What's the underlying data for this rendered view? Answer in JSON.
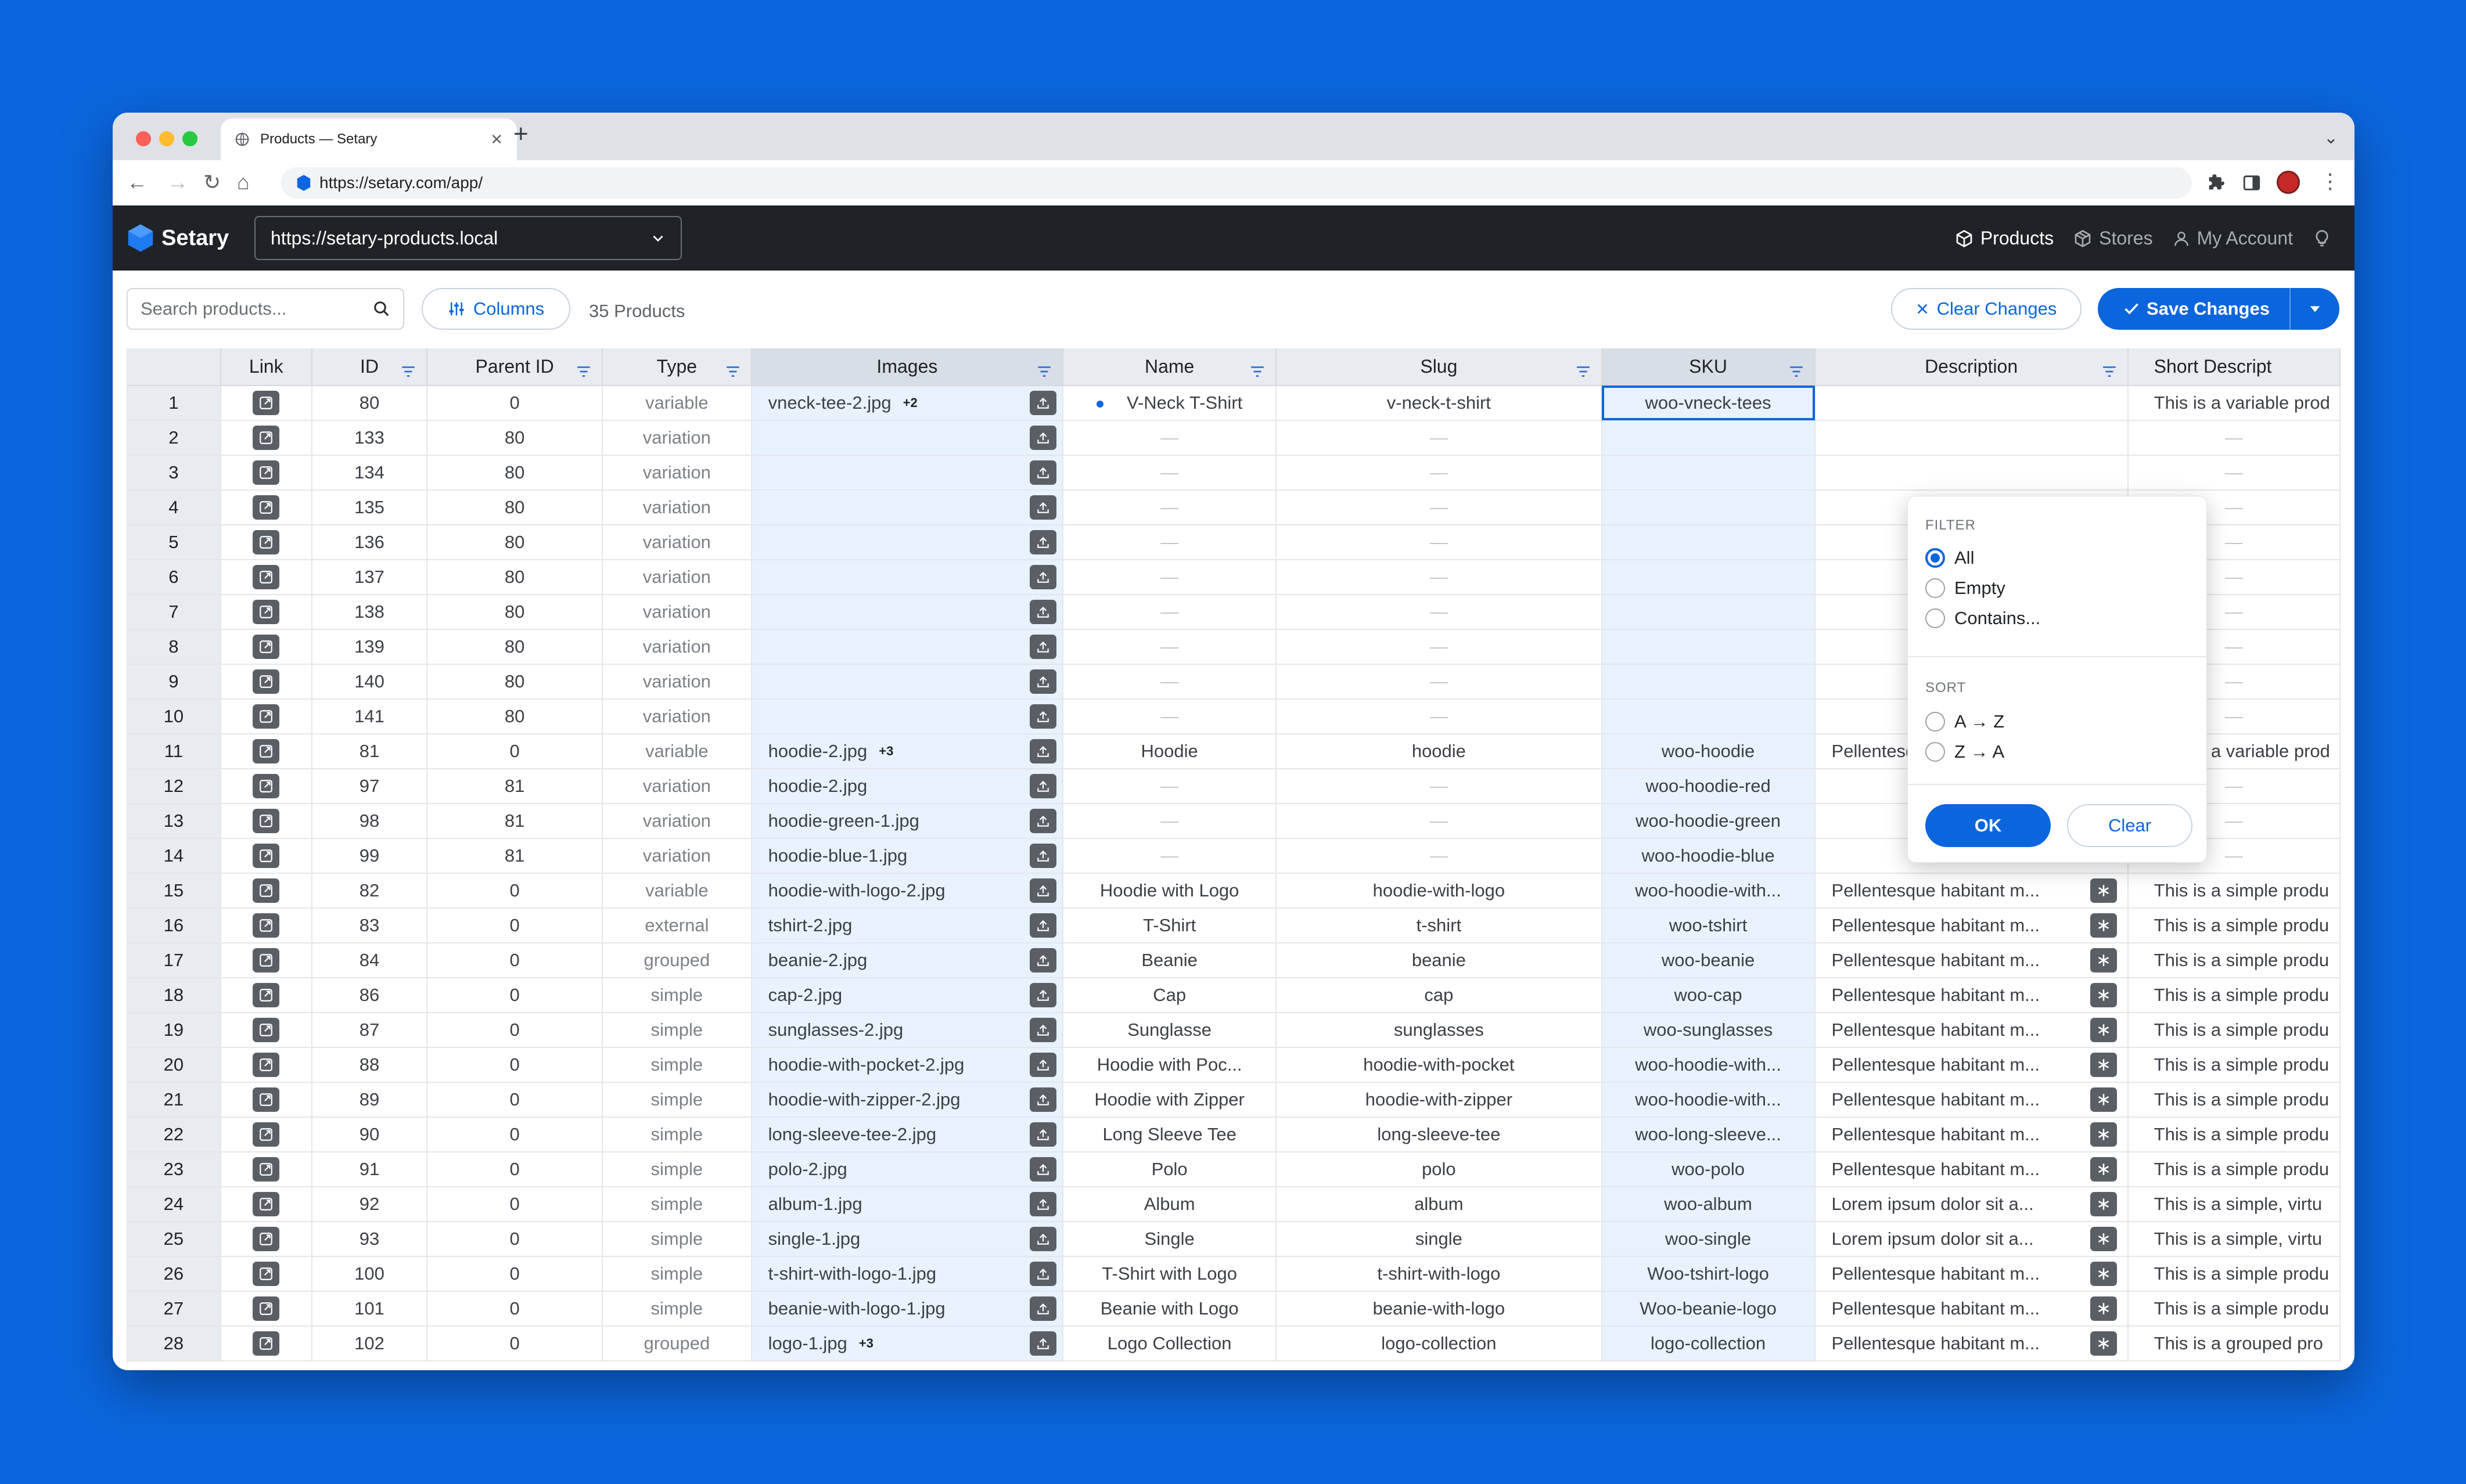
{
  "browser": {
    "tab_title": "Products — Setary",
    "url": "https://setary.com/app/",
    "traffic_colors": [
      "#FF5F57",
      "#FEBC2E",
      "#28C840"
    ]
  },
  "app": {
    "brand": "Setary",
    "site": "https://setary-products.local",
    "nav": [
      {
        "label": "Products",
        "icon": "box-icon",
        "active": true
      },
      {
        "label": "Stores",
        "icon": "cube-icon",
        "active": false
      },
      {
        "label": "My Account",
        "icon": "user-icon",
        "active": false
      }
    ]
  },
  "toolbar": {
    "search_placeholder": "Search products...",
    "columns_label": "Columns",
    "count_label": "35 Products",
    "clear_label": "Clear Changes",
    "save_label": "Save Changes"
  },
  "columns": [
    "",
    "Link",
    "ID",
    "Parent ID",
    "Type",
    "Images",
    "Name",
    "Slug",
    "SKU",
    "Description",
    "Short Descript"
  ],
  "rows": [
    {
      "n": "1",
      "id": "80",
      "parent": "0",
      "type": "variable",
      "img": "vneck-tee-2.jpg",
      "badge": "+2",
      "name": "V-Neck T-Shirt",
      "slug": "v-neck-t-shirt",
      "sku": "woo-vneck-tees",
      "desc": "",
      "sdesc": "This is a variable prod"
    },
    {
      "n": "2",
      "id": "133",
      "parent": "80",
      "type": "variation",
      "img": "",
      "badge": "",
      "name": "—",
      "slug": "—",
      "sku": "",
      "desc": "",
      "sdesc": "—"
    },
    {
      "n": "3",
      "id": "134",
      "parent": "80",
      "type": "variation",
      "img": "",
      "badge": "",
      "name": "—",
      "slug": "—",
      "sku": "",
      "desc": "",
      "sdesc": "—"
    },
    {
      "n": "4",
      "id": "135",
      "parent": "80",
      "type": "variation",
      "img": "",
      "badge": "",
      "name": "—",
      "slug": "—",
      "sku": "",
      "desc": "",
      "sdesc": "—"
    },
    {
      "n": "5",
      "id": "136",
      "parent": "80",
      "type": "variation",
      "img": "",
      "badge": "",
      "name": "—",
      "slug": "—",
      "sku": "",
      "desc": "",
      "sdesc": "—"
    },
    {
      "n": "6",
      "id": "137",
      "parent": "80",
      "type": "variation",
      "img": "",
      "badge": "",
      "name": "—",
      "slug": "—",
      "sku": "",
      "desc": "",
      "sdesc": "—"
    },
    {
      "n": "7",
      "id": "138",
      "parent": "80",
      "type": "variation",
      "img": "",
      "badge": "",
      "name": "—",
      "slug": "—",
      "sku": "",
      "desc": "",
      "sdesc": "—"
    },
    {
      "n": "8",
      "id": "139",
      "parent": "80",
      "type": "variation",
      "img": "",
      "badge": "",
      "name": "—",
      "slug": "—",
      "sku": "",
      "desc": "",
      "sdesc": "—"
    },
    {
      "n": "9",
      "id": "140",
      "parent": "80",
      "type": "variation",
      "img": "",
      "badge": "",
      "name": "—",
      "slug": "—",
      "sku": "",
      "desc": "",
      "sdesc": "—"
    },
    {
      "n": "10",
      "id": "141",
      "parent": "80",
      "type": "variation",
      "img": "",
      "badge": "",
      "name": "—",
      "slug": "—",
      "sku": "",
      "desc": "",
      "sdesc": "—"
    },
    {
      "n": "11",
      "id": "81",
      "parent": "0",
      "type": "variable",
      "img": "hoodie-2.jpg",
      "badge": "+3",
      "name": "Hoodie",
      "slug": "hoodie",
      "sku": "woo-hoodie",
      "desc": "Pellentesque habitant m...",
      "sdesc": "This is a variable prod"
    },
    {
      "n": "12",
      "id": "97",
      "parent": "81",
      "type": "variation",
      "img": "hoodie-2.jpg",
      "badge": "",
      "name": "—",
      "slug": "—",
      "sku": "woo-hoodie-red",
      "desc": "",
      "sdesc": "—"
    },
    {
      "n": "13",
      "id": "98",
      "parent": "81",
      "type": "variation",
      "img": "hoodie-green-1.jpg",
      "badge": "",
      "name": "—",
      "slug": "—",
      "sku": "woo-hoodie-green",
      "desc": "",
      "sdesc": "—"
    },
    {
      "n": "14",
      "id": "99",
      "parent": "81",
      "type": "variation",
      "img": "hoodie-blue-1.jpg",
      "badge": "",
      "name": "—",
      "slug": "—",
      "sku": "woo-hoodie-blue",
      "desc": "",
      "sdesc": "—"
    },
    {
      "n": "15",
      "id": "82",
      "parent": "0",
      "type": "variable",
      "img": "hoodie-with-logo-2.jpg",
      "badge": "",
      "name": "Hoodie with Logo",
      "slug": "hoodie-with-logo",
      "sku": "woo-hoodie-with...",
      "desc": "Pellentesque habitant m...",
      "sdesc": "This is a simple produ"
    },
    {
      "n": "16",
      "id": "83",
      "parent": "0",
      "type": "external",
      "img": "tshirt-2.jpg",
      "badge": "",
      "name": "T-Shirt",
      "slug": "t-shirt",
      "sku": "woo-tshirt",
      "desc": "Pellentesque habitant m...",
      "sdesc": "This is a simple produ"
    },
    {
      "n": "17",
      "id": "84",
      "parent": "0",
      "type": "grouped",
      "img": "beanie-2.jpg",
      "badge": "",
      "name": "Beanie",
      "slug": "beanie",
      "sku": "woo-beanie",
      "desc": "Pellentesque habitant m...",
      "sdesc": "This is a simple produ"
    },
    {
      "n": "18",
      "id": "86",
      "parent": "0",
      "type": "simple",
      "img": "cap-2.jpg",
      "badge": "",
      "name": "Cap",
      "slug": "cap",
      "sku": "woo-cap",
      "desc": "Pellentesque habitant m...",
      "sdesc": "This is a simple produ"
    },
    {
      "n": "19",
      "id": "87",
      "parent": "0",
      "type": "simple",
      "img": "sunglasses-2.jpg",
      "badge": "",
      "name": "Sunglasse",
      "slug": "sunglasses",
      "sku": "woo-sunglasses",
      "desc": "Pellentesque habitant m...",
      "sdesc": "This is a simple produ"
    },
    {
      "n": "20",
      "id": "88",
      "parent": "0",
      "type": "simple",
      "img": "hoodie-with-pocket-2.jpg",
      "badge": "",
      "name": "Hoodie with Poc...",
      "slug": "hoodie-with-pocket",
      "sku": "woo-hoodie-with...",
      "desc": "Pellentesque habitant m...",
      "sdesc": "This is a simple produ"
    },
    {
      "n": "21",
      "id": "89",
      "parent": "0",
      "type": "simple",
      "img": "hoodie-with-zipper-2.jpg",
      "badge": "",
      "name": "Hoodie with Zipper",
      "slug": "hoodie-with-zipper",
      "sku": "woo-hoodie-with...",
      "desc": "Pellentesque habitant m...",
      "sdesc": "This is a simple produ"
    },
    {
      "n": "22",
      "id": "90",
      "parent": "0",
      "type": "simple",
      "img": "long-sleeve-tee-2.jpg",
      "badge": "",
      "name": "Long Sleeve Tee",
      "slug": "long-sleeve-tee",
      "sku": "woo-long-sleeve...",
      "desc": "Pellentesque habitant m...",
      "sdesc": "This is a simple produ"
    },
    {
      "n": "23",
      "id": "91",
      "parent": "0",
      "type": "simple",
      "img": "polo-2.jpg",
      "badge": "",
      "name": "Polo",
      "slug": "polo",
      "sku": "woo-polo",
      "desc": "Pellentesque habitant m...",
      "sdesc": "This is a simple produ"
    },
    {
      "n": "24",
      "id": "92",
      "parent": "0",
      "type": "simple",
      "img": "album-1.jpg",
      "badge": "",
      "name": "Album",
      "slug": "album",
      "sku": "woo-album",
      "desc": "Lorem ipsum dolor sit a...",
      "sdesc": "This is a simple, virtu"
    },
    {
      "n": "25",
      "id": "93",
      "parent": "0",
      "type": "simple",
      "img": "single-1.jpg",
      "badge": "",
      "name": "Single",
      "slug": "single",
      "sku": "woo-single",
      "desc": "Lorem ipsum dolor sit a...",
      "sdesc": "This is a simple, virtu"
    },
    {
      "n": "26",
      "id": "100",
      "parent": "0",
      "type": "simple",
      "img": "t-shirt-with-logo-1.jpg",
      "badge": "",
      "name": "T-Shirt with Logo",
      "slug": "t-shirt-with-logo",
      "sku": "Woo-tshirt-logo",
      "desc": "Pellentesque habitant m...",
      "sdesc": "This is a simple produ"
    },
    {
      "n": "27",
      "id": "101",
      "parent": "0",
      "type": "simple",
      "img": "beanie-with-logo-1.jpg",
      "badge": "",
      "name": "Beanie with Logo",
      "slug": "beanie-with-logo",
      "sku": "Woo-beanie-logo",
      "desc": "Pellentesque habitant m...",
      "sdesc": "This is a simple produ"
    },
    {
      "n": "28",
      "id": "102",
      "parent": "0",
      "type": "grouped",
      "img": "logo-1.jpg",
      "badge": "+3",
      "name": "Logo Collection",
      "slug": "logo-collection",
      "sku": "logo-collection",
      "desc": "Pellentesque habitant m...",
      "sdesc": "This is a grouped pro"
    }
  ],
  "filter_popup": {
    "filter_heading": "FILTER",
    "filter_options": [
      "All",
      "Empty",
      "Contains..."
    ],
    "selected": "All",
    "sort_heading": "SORT",
    "sort_options": [
      "A → Z",
      "Z → A"
    ],
    "ok_label": "OK",
    "clear_label": "Clear"
  },
  "colors": {
    "accent": "#0B66DD",
    "appbar": "#1F2327",
    "highlight": "#E7F2FD"
  }
}
